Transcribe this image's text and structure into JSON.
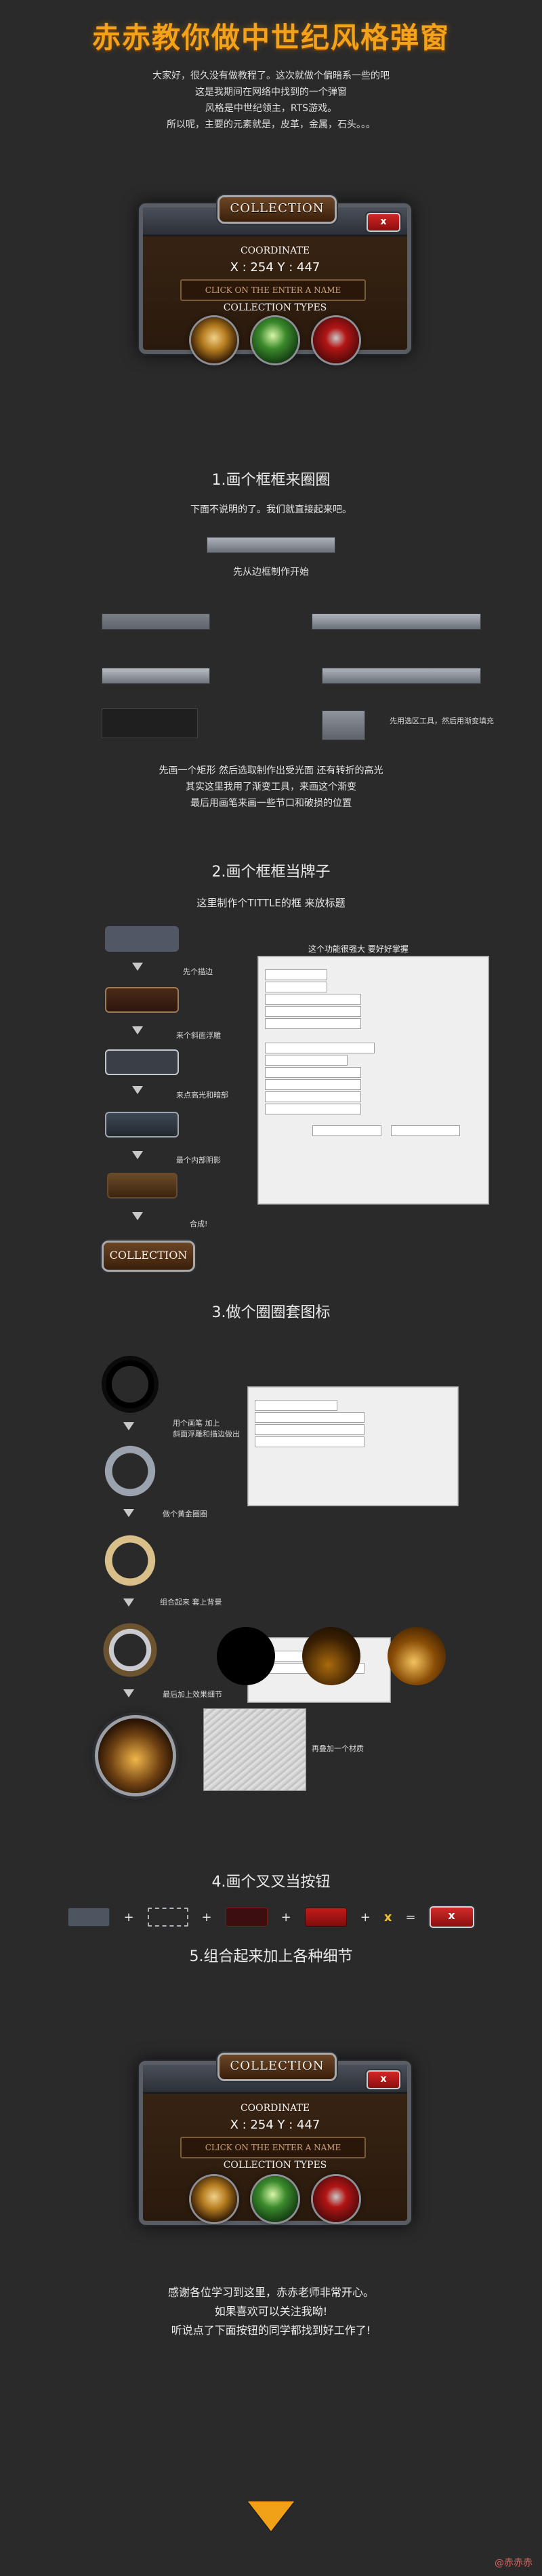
{
  "page": {
    "title": "赤赤教你做中世纪风格弹窗",
    "intro_lines": [
      "大家好，很久没有做教程了。这次就做个偏暗系一些的吧",
      "这是我期间在网络中找到的一个弹窗",
      "风格是中世纪领主，RTS游戏。",
      "所以呢，主要的元素就是，皮革，金属，石头。。。"
    ]
  },
  "modal": {
    "ribbon_title": "COLLECTION",
    "close_label": "x",
    "coordinate_label": "COORDINATE",
    "coordinate_values": "X : 254   Y : 447",
    "name_placeholder": "CLICK ON THE ENTER A NAME",
    "types_label": "COLLECTION TYPES"
  },
  "sections": {
    "s1_title": "1.画个框框来圈圈",
    "s1_line1": "下面不说明的了。我们就直接起来吧。",
    "s1_line2": "先从边框制作开始",
    "s1_note_right": "先用选区工具，然后用渐变填充",
    "s1_para": [
      "先画一个矩形 然后选取制作出受光面 还有转折的高光",
      "其实这里我用了渐变工具，来画这个渐变",
      "最后用画笔来画一些节口和破损的位置"
    ],
    "s2_title": "2.画个框框当牌子",
    "s2_subtitle": "这里制作个TITTLE的框 来放标题",
    "s2_panel_title": "这个功能很强大 要好好掌握",
    "s2_steps": [
      "先个描边",
      "来个斜面浮雕",
      "来点高光和暗部",
      "最个内部阴影",
      "合成!"
    ],
    "s2_final_label": "COLLECTION",
    "s3_title": "3.做个圈圈套图标",
    "s3_steps": [
      "用个画笔 加上",
      "斜面浮雕和描边做出",
      "做个黄金圈圈",
      "组合起来 套上背景",
      "最后加上效果细节",
      "再叠加一个材质"
    ],
    "s4_title": "4.画个叉叉当按钮",
    "s5_title": "5.组合起来加上各种细节",
    "outro": [
      "感谢各位学习到这里，赤赤老师非常开心。",
      "如果喜欢可以关注我呦!",
      "听说点了下面按钮的同学都找到好工作了!"
    ]
  },
  "watermark": "@赤赤赤",
  "icons": {
    "ring": "golden-ring-icon",
    "gold": "gold-coin-icon",
    "stone": "stone-hammer-icon",
    "arrow": "down-arrow-icon"
  },
  "colors": {
    "accent": "#f2a21b",
    "modal_bg": "#2a1a0d",
    "close_red": "#c01f1f"
  }
}
